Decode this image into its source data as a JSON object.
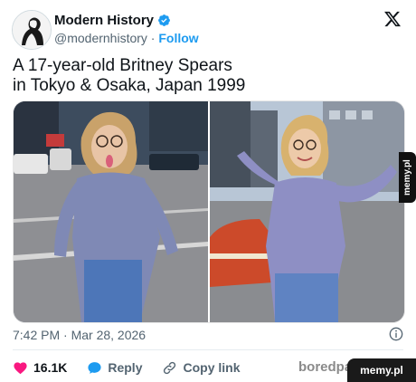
{
  "header": {
    "display_name": "Modern History",
    "handle": "@modernhistory",
    "separator": " · ",
    "follow_label": "Follow"
  },
  "tweet": {
    "text": "A 17-year-old Britney Spears\nin Tokyo & Osaka, Japan 1999",
    "timestamp": "7:42 PM · Mar 28, 2026"
  },
  "actions": {
    "likes": "16.1K",
    "reply_label": "Reply",
    "copy_link_label": "Copy link"
  },
  "watermarks": {
    "side": "memy.pl",
    "boredpanda": "boredpa",
    "memy": "memy.pl"
  },
  "colors": {
    "accent": "#1d9bf0",
    "like": "#f91880",
    "text": "#0f1419",
    "muted": "#536471"
  }
}
